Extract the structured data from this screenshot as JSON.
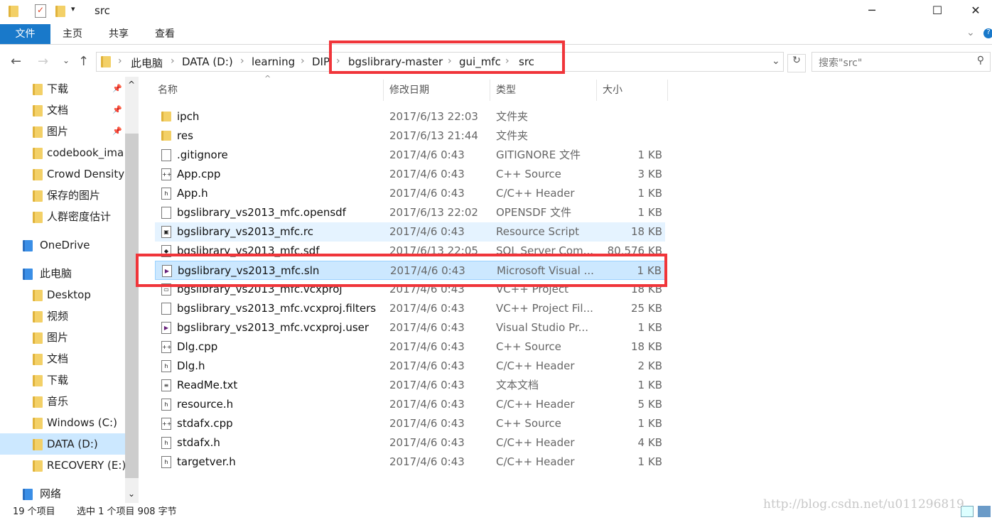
{
  "window": {
    "title": "src",
    "minimize": "─",
    "maximize": "☐",
    "close": "✕"
  },
  "ribbon": {
    "tabs": [
      "文件",
      "主页",
      "共享",
      "查看"
    ]
  },
  "address": {
    "crumbs": [
      "此电脑",
      "DATA (D:)",
      "learning",
      "DIP",
      "bgslibrary-master",
      "gui_mfc",
      "src"
    ]
  },
  "search": {
    "placeholder": "搜索\"src\""
  },
  "sidebar": {
    "items": [
      {
        "label": "下载",
        "pinned": true
      },
      {
        "label": "文档",
        "pinned": true
      },
      {
        "label": "图片",
        "pinned": true
      },
      {
        "label": "codebook_ima"
      },
      {
        "label": "Crowd Density"
      },
      {
        "label": "保存的图片"
      },
      {
        "label": "人群密度估计"
      },
      {
        "label": "OneDrive",
        "top": true
      },
      {
        "label": "此电脑",
        "top": true
      },
      {
        "label": "Desktop"
      },
      {
        "label": "视频"
      },
      {
        "label": "图片"
      },
      {
        "label": "文档"
      },
      {
        "label": "下载"
      },
      {
        "label": "音乐"
      },
      {
        "label": "Windows (C:)"
      },
      {
        "label": "DATA (D:)",
        "selected": true
      },
      {
        "label": "RECOVERY (E:)"
      },
      {
        "label": "网络",
        "top": true
      }
    ]
  },
  "columns": [
    "名称",
    "修改日期",
    "类型",
    "大小"
  ],
  "files": [
    {
      "name": "ipch",
      "date": "2017/6/13 22:03",
      "type": "文件夹",
      "size": "",
      "icon": "folder"
    },
    {
      "name": "res",
      "date": "2017/6/13 21:44",
      "type": "文件夹",
      "size": "",
      "icon": "folder"
    },
    {
      "name": ".gitignore",
      "date": "2017/4/6 0:43",
      "type": "GITIGNORE 文件",
      "size": "1 KB",
      "icon": "file"
    },
    {
      "name": "App.cpp",
      "date": "2017/4/6 0:43",
      "type": "C++ Source",
      "size": "3 KB",
      "icon": "cpp"
    },
    {
      "name": "App.h",
      "date": "2017/4/6 0:43",
      "type": "C/C++ Header",
      "size": "1 KB",
      "icon": "h"
    },
    {
      "name": "bgslibrary_vs2013_mfc.opensdf",
      "date": "2017/6/13 22:02",
      "type": "OPENSDF 文件",
      "size": "1 KB",
      "icon": "file"
    },
    {
      "name": "bgslibrary_vs2013_mfc.rc",
      "date": "2017/4/6 0:43",
      "type": "Resource Script",
      "size": "18 KB",
      "icon": "rc",
      "state": "hover"
    },
    {
      "name": "bgslibrary_vs2013_mfc.sdf",
      "date": "2017/6/13 22:05",
      "type": "SQL Server Com...",
      "size": "80,576 KB",
      "icon": "sdf"
    },
    {
      "name": "bgslibrary_vs2013_mfc.sln",
      "date": "2017/4/6 0:43",
      "type": "Microsoft Visual ...",
      "size": "1 KB",
      "icon": "sln",
      "state": "selected"
    },
    {
      "name": "bgslibrary_vs2013_mfc.vcxproj",
      "date": "2017/4/6 0:43",
      "type": "VC++ Project",
      "size": "18 KB",
      "icon": "vcx"
    },
    {
      "name": "bgslibrary_vs2013_mfc.vcxproj.filters",
      "date": "2017/4/6 0:43",
      "type": "VC++ Project Fil...",
      "size": "25 KB",
      "icon": "file"
    },
    {
      "name": "bgslibrary_vs2013_mfc.vcxproj.user",
      "date": "2017/4/6 0:43",
      "type": "Visual Studio Pr...",
      "size": "1 KB",
      "icon": "vs"
    },
    {
      "name": "Dlg.cpp",
      "date": "2017/4/6 0:43",
      "type": "C++ Source",
      "size": "18 KB",
      "icon": "cpp"
    },
    {
      "name": "Dlg.h",
      "date": "2017/4/6 0:43",
      "type": "C/C++ Header",
      "size": "2 KB",
      "icon": "h"
    },
    {
      "name": "ReadMe.txt",
      "date": "2017/4/6 0:43",
      "type": "文本文档",
      "size": "1 KB",
      "icon": "txt"
    },
    {
      "name": "resource.h",
      "date": "2017/4/6 0:43",
      "type": "C/C++ Header",
      "size": "5 KB",
      "icon": "h"
    },
    {
      "name": "stdafx.cpp",
      "date": "2017/4/6 0:43",
      "type": "C++ Source",
      "size": "1 KB",
      "icon": "cpp"
    },
    {
      "name": "stdafx.h",
      "date": "2017/4/6 0:43",
      "type": "C/C++ Header",
      "size": "4 KB",
      "icon": "h"
    },
    {
      "name": "targetver.h",
      "date": "2017/4/6 0:43",
      "type": "C/C++ Header",
      "size": "1 KB",
      "icon": "h"
    }
  ],
  "status": {
    "count": "19 个项目",
    "selection": "选中 1 个项目  908 字节"
  },
  "watermark": "http://blog.csdn.net/u011296819",
  "colors": {
    "accent": "#1979ca",
    "selected": "#cce8ff",
    "hover": "#e5f3ff",
    "highlight": "#f0353a"
  }
}
